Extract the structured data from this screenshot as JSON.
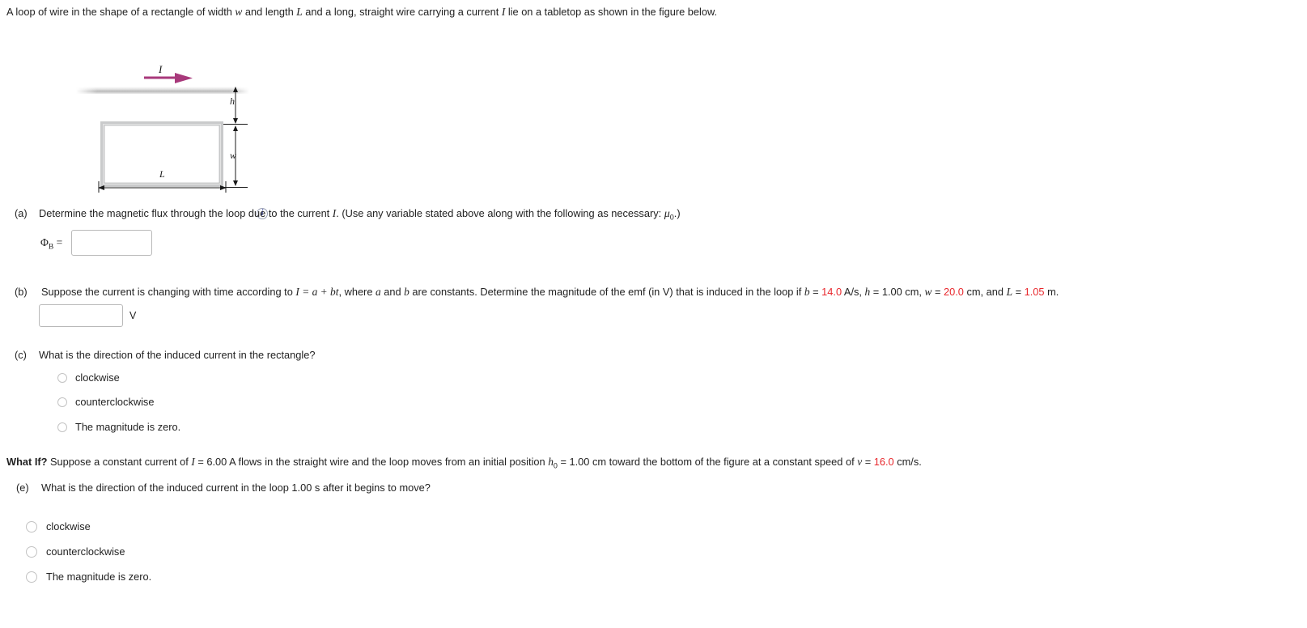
{
  "intro": {
    "part1": "A loop of wire in the shape of a rectangle of width ",
    "w": "w",
    "part2": " and length ",
    "L": "L",
    "part3": " and a long, straight wire carrying a current ",
    "I": "I",
    "part4": " lie on a tabletop as shown in the figure below."
  },
  "figure": {
    "current_label": "I",
    "height_label": "h",
    "width_label": "w",
    "length_label": "L",
    "info_icon": "i",
    "arrow_color": "#a8397b",
    "wire_color": "#bdbdbd",
    "loop_color": "#c9cacb"
  },
  "question_a": {
    "tag": "(a)",
    "text_1": "Determine the magnetic flux through the loop due to the current ",
    "text_I": "I",
    "text_2": ". (Use any variable stated above along with the following as necessary: ",
    "mu": "μ",
    "mu_sub": "0",
    "text_3": ".)",
    "answer_label_phi": "Φ",
    "answer_label_sub": "B",
    "answer_label_eq": " =",
    "answer_value": "",
    "answer_placeholder": ""
  },
  "question_b": {
    "tag": "(b)",
    "text_1": "Suppose the current is changing with time according to ",
    "eq_I": "I",
    "eq_rest": " = a + bt",
    "text_2": ", where ",
    "var_a": "a",
    "text_3": " and ",
    "var_b": "b",
    "text_4": " are constants. Determine the magnitude of the emf (in V) that is induced in the loop if ",
    "b_var": "b",
    "b_eq": " = ",
    "b_value": "14.0",
    "b_unit": " A/s, ",
    "h_var": "h",
    "h_eq": " = ",
    "h_value": "1.00",
    "h_unit": " cm, ",
    "w_var": "w",
    "w_eq": " = ",
    "w_value": "20.0",
    "w_unit": " cm, and ",
    "L_var": "L",
    "L_eq": " = ",
    "L_value": "1.05",
    "L_unit": " m.",
    "answer_value": "",
    "unit": "V"
  },
  "question_c": {
    "tag": "(c)",
    "text": "What is the direction of the induced current in the rectangle?",
    "options": [
      {
        "label": "clockwise",
        "selected": false
      },
      {
        "label": "counterclockwise",
        "selected": false
      },
      {
        "label": "The magnitude is zero.",
        "selected": false
      }
    ]
  },
  "what_if": {
    "prefix": "What If?",
    "text_1": " Suppose a constant current of ",
    "I_var": "I",
    "I_eq": " = 6.00 A flows in the straight wire and the loop moves from an initial position ",
    "h_var": "h",
    "h_sub": "0",
    "h_eq": " = 1.00 cm toward the bottom of the figure at a constant speed of ",
    "v_var": "v",
    "v_eq": " = ",
    "v_value": "16.0",
    "v_unit": " cm/s."
  },
  "question_e": {
    "tag": "(e)",
    "text": "What is the direction of the induced current in the loop 1.00 s after it begins to move?",
    "options": [
      {
        "label": "clockwise",
        "selected": false
      },
      {
        "label": "counterclockwise",
        "selected": false
      },
      {
        "label": "The magnitude is zero.",
        "selected": false
      }
    ]
  }
}
